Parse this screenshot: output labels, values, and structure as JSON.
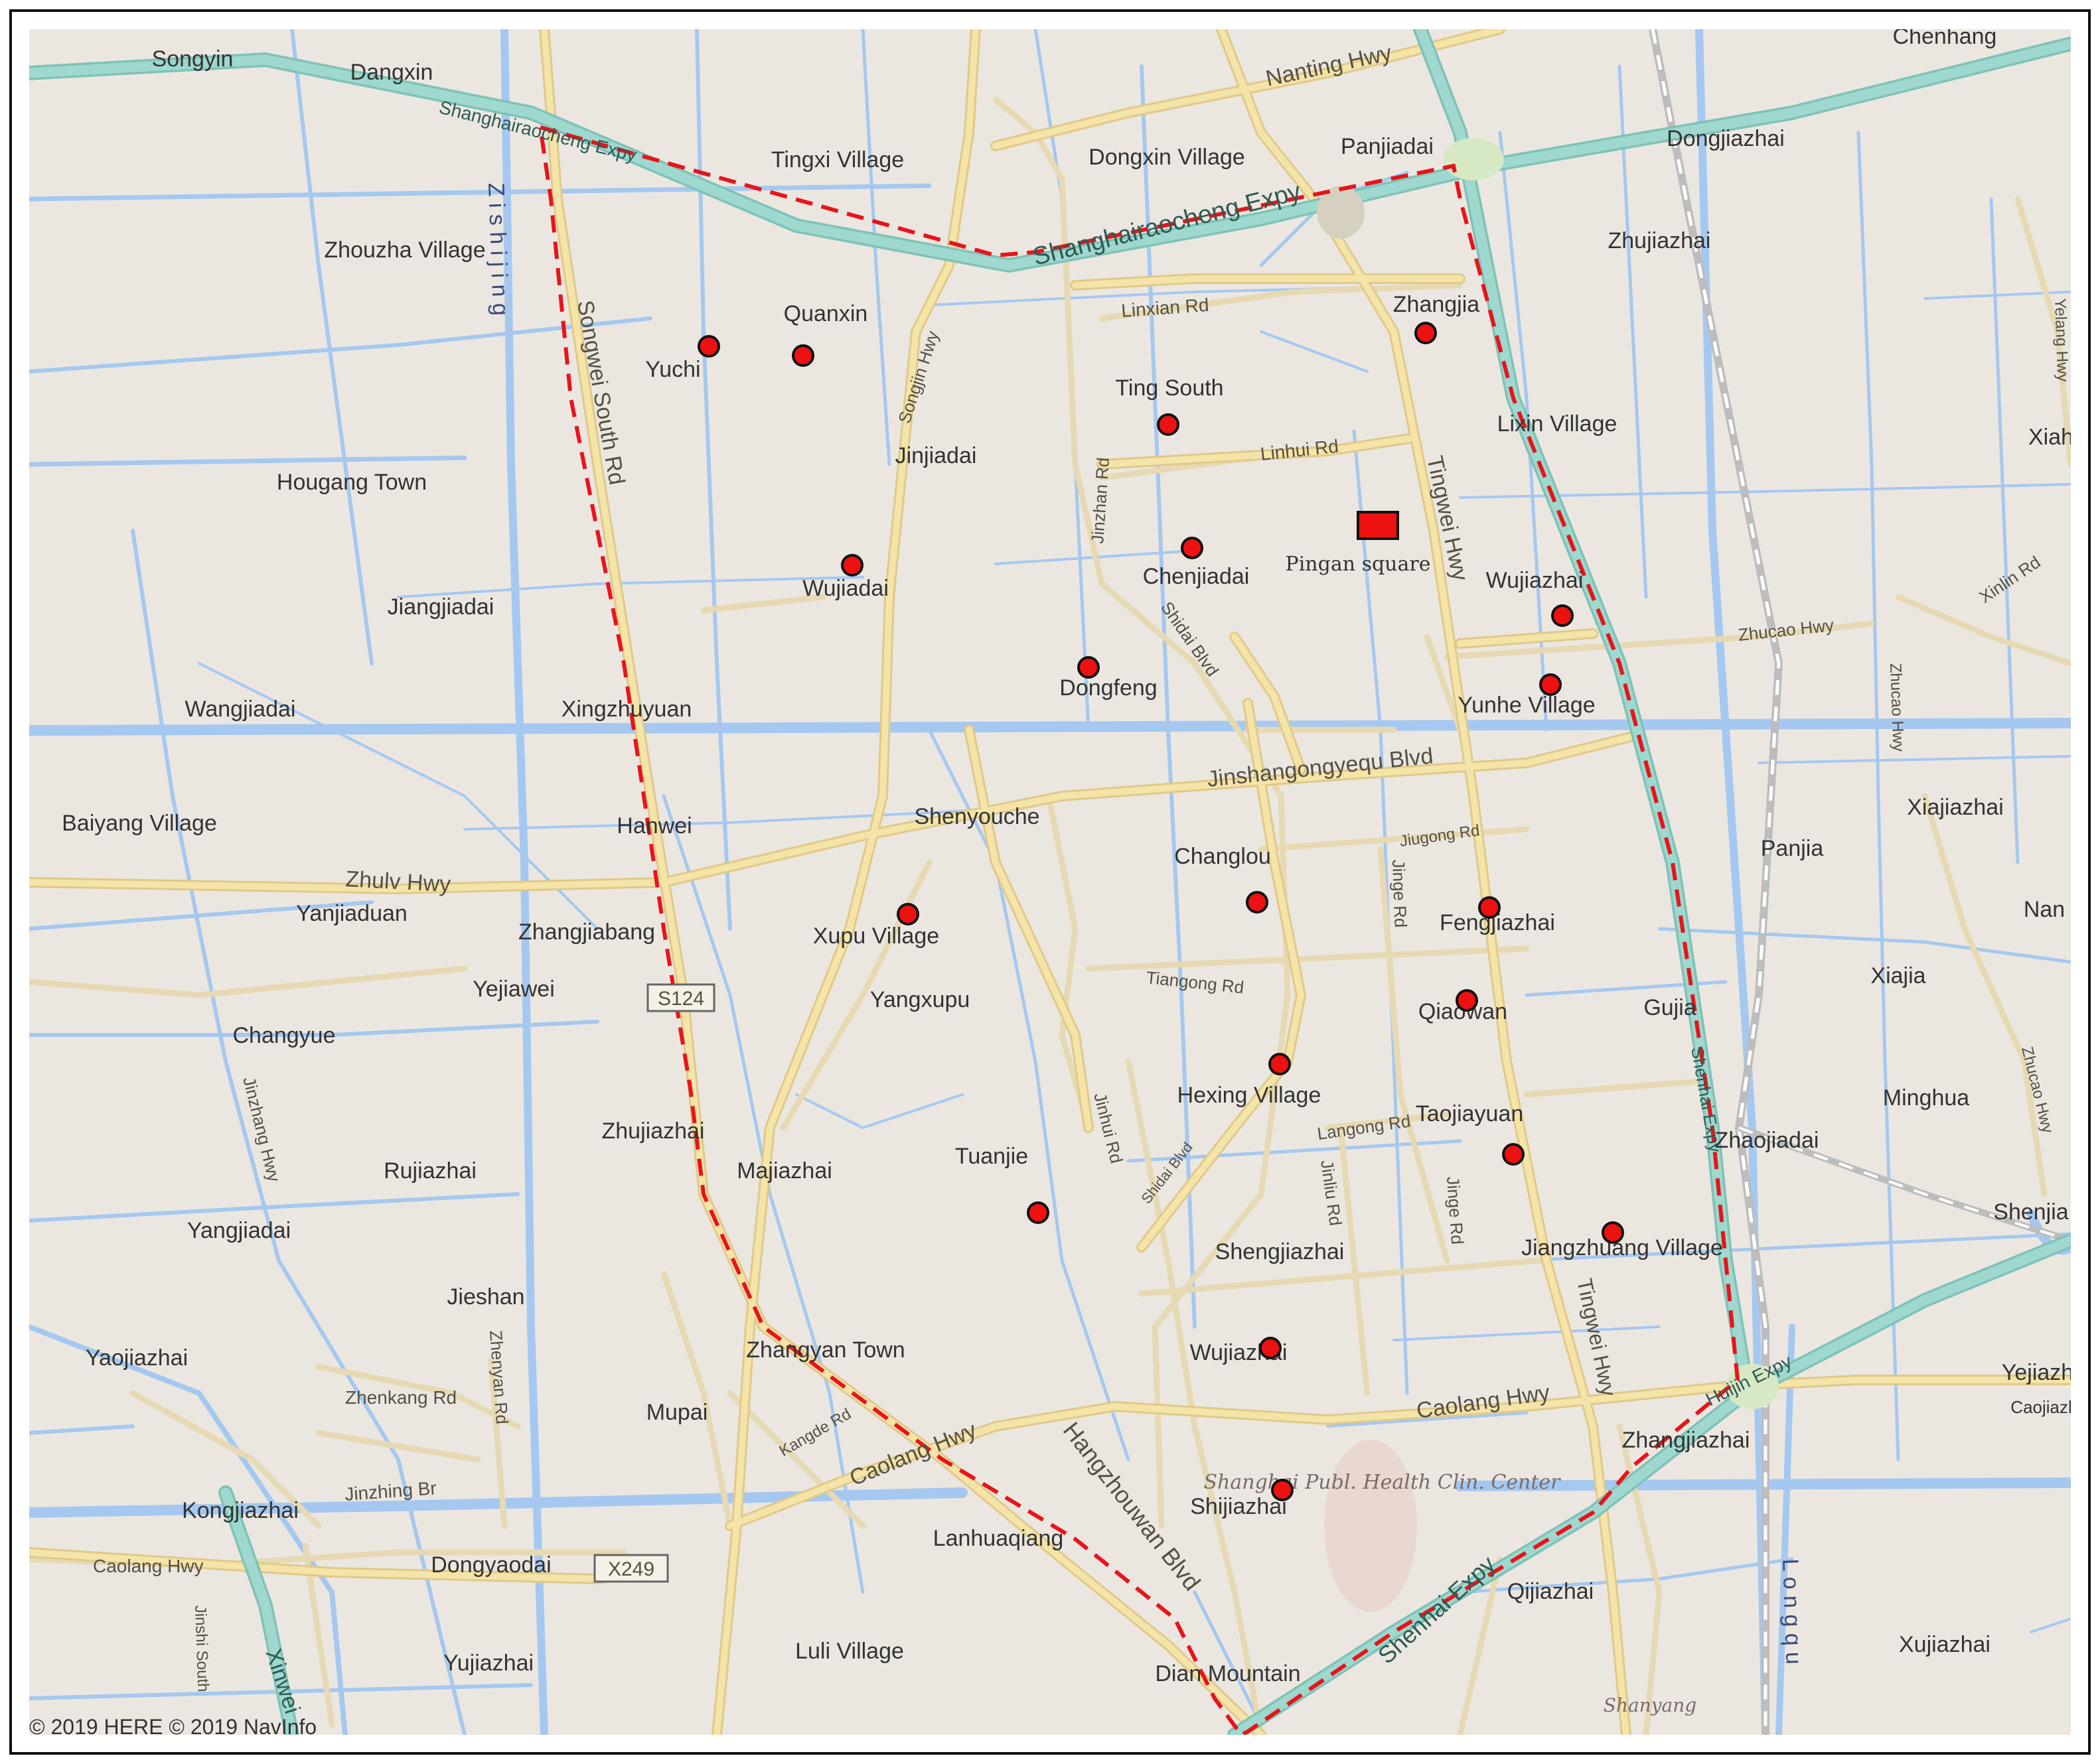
{
  "map": {
    "copyright": "© 2019 HERE © 2019 NavInfo",
    "colors": {
      "land": "#ebe7e0",
      "water": "#a5c8f0",
      "expressway": "#9ed8cf",
      "expressway_edge": "#7fc2b7",
      "highway": "#f5e4a8",
      "highway_edge": "#e0c98a",
      "road": "#f7f3ea",
      "boundary": "#e8141b",
      "marker": "#ee1111",
      "rail": "#c8c8c8"
    },
    "places": [
      "Songyin",
      "Dangxin",
      "Tingxi Village",
      "Dongxin Village",
      "Panjiadai",
      "Dongjiazhai",
      "Chenhang",
      "Zhouzha Village",
      "Zhujiazhai",
      "Quanxin",
      "Yuchi",
      "Zhangjia",
      "Ting South",
      "Lixin Village",
      "Xiah",
      "Jinjiadai",
      "Hougang Town",
      "Wujiadai",
      "Chenjiadai",
      "Wujiazhai",
      "Jiangjiadai",
      "Dongfeng",
      "Yunhe Village",
      "Wangjiadai",
      "Xingzhuyuan",
      "Baiyang Village",
      "Hanwei",
      "Shenyouche",
      "Xiajiazhai",
      "Panjia",
      "Changlou",
      "Nan",
      "Yanjiaduan",
      "Zhangjiabang",
      "Xupu Village",
      "Fengjiazhai",
      "Yejiawei",
      "Yangxupu",
      "Qiaowan",
      "Gujia",
      "Xiajia",
      "Changyue",
      "Hexing Village",
      "Taojiayuan",
      "Minghua",
      "Zhujiazhai",
      "Majiazhai",
      "Tuanjie",
      "Zhaojiadai",
      "Rujiazhai",
      "Yangjiadai",
      "Shengjiazhai",
      "Jiangzhuang Village",
      "Shenjia",
      "Jieshan",
      "Yaojiazhai",
      "Zhangyan Town",
      "Wujiazhai",
      "Yejiazh",
      "Mupai",
      "Zhangjiazhai",
      "Kongjiazhai",
      "Shijiazhai",
      "Dongyaodai",
      "Lanhuaqiang",
      "Qijiazhai",
      "Yujiazhai",
      "Luli Village",
      "Dian Mountain",
      "Xujiazhai",
      "Caojiazhai",
      "Shanyang"
    ],
    "roads": {
      "shanghaiaocheng_expy": "Shanghairaocheng Expy",
      "nanting_hwy": "Nanting Hwy",
      "linxian_rd": "Linxian Rd",
      "linhui_rd": "Linhui Rd",
      "songwei_south_rd": "Songwei South Rd",
      "songjin_hwy": "Songjin Hwy",
      "jinzhan_rd": "Jinzhan Rd",
      "shidai_blvd": "Shidai Blvd",
      "tingwei_hwy": "Tingwei Hwy",
      "zhucao_hwy": "Zhucao Hwy",
      "xinlin_rd": "Xinlin Rd",
      "yelang_hwy": "Yelang Hwy",
      "jinshangongyequ_blvd": "Jinshangongyequ Blvd",
      "jiugong_rd": "Jiugong Rd",
      "zhulv_hwy": "Zhulv Hwy",
      "jinge_rd": "Jinge Rd",
      "s124": "S124",
      "tiangong_rd": "Tiangong Rd",
      "jinhui_rd": "Jinhui Rd",
      "langong_rd": "Langong Rd",
      "jinliu_rd": "Jinliu Rd",
      "jinzhang_hwy": "Jinzhang Hwy",
      "shenhai_expy": "Shenhai Expy",
      "zhenyan_rd": "Zhenyan Rd",
      "zhenkang_rd": "Zhenkang Rd",
      "kangde_rd": "Kangde Rd",
      "caolang_hwy": "Caolang Hwy",
      "hangzhouwan_blvd": "Hangzhouwan Blvd",
      "huijin_expy": "Huijin Expy",
      "jinzhing_br": "Jinzhing Br",
      "x249": "X249",
      "jinshi_south": "Jinshi South",
      "xinwei": "Xinwei",
      "shenhai_expy_2": "Shenhai Expy"
    },
    "waterways": {
      "zishijing": "Z i s h i  j i n g",
      "longqu": "L o n g q u"
    },
    "poi": {
      "hospital": "Shanghai Publ. Health Clin. Center",
      "square": "Pingan square"
    },
    "markers": [
      "Yuchi",
      "Quanxin",
      "Zhangjia",
      "Ting South",
      "Wujiadai",
      "Chenjiadai",
      "Wujiazhai",
      "Dongfeng",
      "Yunhe Village",
      "Changlou",
      "Fengjiazhai",
      "Xupu Village",
      "Qiaowan",
      "Hexing Village",
      "Taojiayuan",
      "Tuanjie",
      "Jiangzhuang Village",
      "Wujiazhai",
      "Shijiazhai"
    ]
  }
}
